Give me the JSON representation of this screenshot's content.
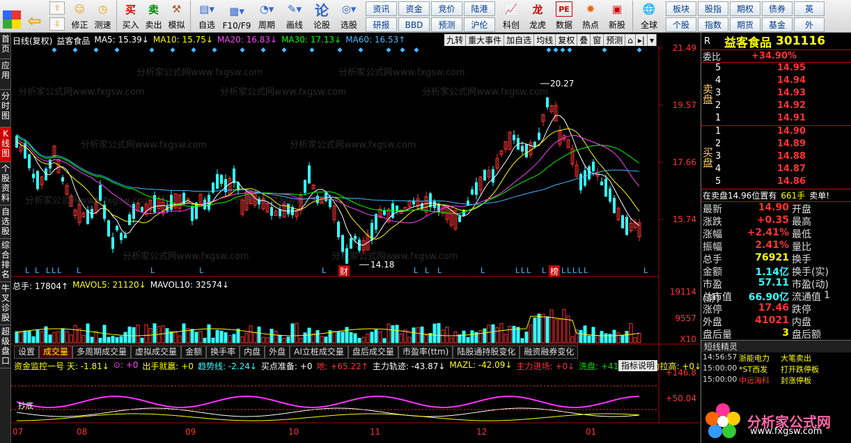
{
  "toolbar": {
    "buttons": [
      {
        "label": "",
        "icon": "grid-icon"
      },
      {
        "label": "",
        "icon": "back-arrow-icon"
      },
      {
        "label": "修正",
        "icon": "smile-icon"
      },
      {
        "label": "测速",
        "icon": "clock-icon"
      },
      {
        "label": "买入",
        "icon": "buy-icon"
      },
      {
        "label": "卖出",
        "icon": "sell-icon"
      },
      {
        "label": "模拟",
        "icon": "hammer-icon"
      },
      {
        "label": "自选",
        "icon": "folder-icon"
      },
      {
        "label": "F10/F9",
        "icon": "f10-icon"
      },
      {
        "label": "周期",
        "icon": "cycle-icon"
      },
      {
        "label": "画线",
        "icon": "pen-icon"
      },
      {
        "label": "论股",
        "icon": "talk-icon"
      },
      {
        "label": "选股",
        "icon": "pick-icon"
      }
    ],
    "grid_left": [
      "资讯",
      "资金",
      "竞价",
      "陆港",
      "研报",
      "BBD",
      "预测",
      "沪伦"
    ],
    "buttons2": [
      {
        "label": "科创",
        "icon": "chart-icon"
      },
      {
        "label": "龙虎",
        "icon": "dragon-icon"
      },
      {
        "label": "数据",
        "icon": "pe-icon"
      },
      {
        "label": "热点",
        "icon": "hot-icon"
      },
      {
        "label": "新股",
        "icon": "ipo-icon"
      },
      {
        "label": "全球",
        "icon": "globe-icon"
      }
    ],
    "grid_right": [
      "板块",
      "股指",
      "期权",
      "债券",
      "英",
      "个股",
      "指数",
      "期货",
      "基金",
      "外"
    ]
  },
  "left_tabs": [
    "首页",
    "应用",
    "分时图",
    "K线图",
    "个股资料",
    "自选股",
    "综合排名",
    "牛叉诊股",
    "超级盘口"
  ],
  "header": {
    "period": "日线(复权)",
    "stock": "益客食品",
    "ma5": "MA5: 15.39↓",
    "ma10": "MA10: 15.75↓",
    "ma20": "MA20: 16.83↓",
    "ma30": "MA30: 17.13↓",
    "ma60": "MA60: 16.53↑"
  },
  "top_buttons": [
    "九转",
    "重大事件",
    "加自选",
    "均线",
    "复权",
    "叠",
    "窗",
    "预测"
  ],
  "price_axis": [
    "21.49",
    "19.57",
    "17.66",
    "15.74",
    "14.18",
    "20.27"
  ],
  "vol_header": {
    "total": "总手: 17804↑",
    "mavol5": "MAVOL5: 21120↓",
    "mavol10": "MAVOL10: 32574↓"
  },
  "vol_axis": [
    "19114",
    "9557",
    "X10"
  ],
  "sub_tabs": [
    "设置",
    "成交量",
    "多周期成交量",
    "虚拟成交量",
    "金额",
    "换手率",
    "内盘",
    "外盘",
    "AI立桩成交量",
    "盘后成交量",
    "市盈率(ttm)",
    "陆股通持股变化",
    "融资融券变化"
  ],
  "indicator": {
    "name": "资金监控一号 天: -1.81↓",
    "f1": "⊙: +0",
    "f2": "出手就赢: +0",
    "f3": "趋势线: -2.24↓",
    "f4": "买点准备: +0",
    "f5": "地: +65.22↑",
    "f6": "主力轨迹: -43.87↓",
    "f7": "MAZL: -42.09↓",
    "f8": "主力进场: +0↓",
    "f9": "洗盘: +41.14↑",
    "f10": "主力拉高: +0↓",
    "button": "指标说明",
    "axis": [
      "+146.8",
      "+50.04"
    ],
    "markers": "抄底"
  },
  "x_axis": [
    "07",
    "08",
    "09",
    "10",
    "11",
    "12",
    "01"
  ],
  "markers": {
    "low_mark": "L",
    "cai": "财",
    "bang": "榜"
  },
  "watermark": "分析家公式网www.fxgsw.com",
  "right": {
    "r": "R",
    "name": "益客食品",
    "code": "301116",
    "weibi_label": "委比",
    "weibi": "+34.90%",
    "sell_label": "卖盘",
    "buy_label": "买盘",
    "sell": [
      {
        "n": "5",
        "p": "14.95"
      },
      {
        "n": "4",
        "p": "14.94"
      },
      {
        "n": "3",
        "p": "14.93"
      },
      {
        "n": "2",
        "p": "14.92"
      },
      {
        "n": "1",
        "p": "14.91"
      }
    ],
    "buy": [
      {
        "n": "1",
        "p": "14.90"
      },
      {
        "n": "2",
        "p": "14.89"
      },
      {
        "n": "3",
        "p": "14.88"
      },
      {
        "n": "4",
        "p": "14.87"
      },
      {
        "n": "5",
        "p": "14.86"
      }
    ],
    "ob_line": "在卖盘14.96位置有",
    "ob_qty": "661手",
    "ob_sell": "卖单!",
    "quotes": [
      {
        "k": "最新",
        "v": "14.90",
        "c": "red",
        "k2": "开盘",
        "v2": ""
      },
      {
        "k": "涨跌",
        "v": "+0.35",
        "c": "red",
        "k2": "最高",
        "v2": ""
      },
      {
        "k": "涨幅",
        "v": "+2.41%",
        "c": "red",
        "k2": "最低",
        "v2": ""
      },
      {
        "k": "振幅",
        "v": "2.41%",
        "c": "red",
        "k2": "量比",
        "v2": ""
      },
      {
        "k": "总手",
        "v": "76921",
        "c": "yel",
        "k2": "换手",
        "v2": ""
      },
      {
        "k": "金额",
        "v": "1.14亿",
        "c": "cyan",
        "k2": "换手(实)",
        "v2": ""
      },
      {
        "k": "市盈(静)",
        "v": "57.11",
        "c": "cyan",
        "k2": "市盈(动)",
        "v2": ""
      },
      {
        "k": "总市值",
        "v": "66.90亿",
        "c": "cyan",
        "k2": "流通值",
        "v2": "1"
      },
      {
        "k": "涨停",
        "v": "17.46",
        "c": "red",
        "k2": "跌停",
        "v2": ""
      },
      {
        "k": "外盘",
        "v": "41021",
        "c": "red",
        "k2": "内盘",
        "v2": ""
      },
      {
        "k": "盘后量",
        "v": "3",
        "c": "yel",
        "k2": "盘后额",
        "v2": ""
      }
    ],
    "news_title": "短线精灵",
    "news": [
      {
        "t": "14:56:57",
        "s": "浙能电力",
        "e": "大笔卖出"
      },
      {
        "t": "15:00:00",
        "s": "*ST西发",
        "e": "打开跌停板"
      },
      {
        "t": "15:00:00",
        "s": "中远海科",
        "e": "封涨停板"
      }
    ],
    "logo_text": "分析家公式网",
    "logo_url": "www.fxgsw.com"
  }
}
